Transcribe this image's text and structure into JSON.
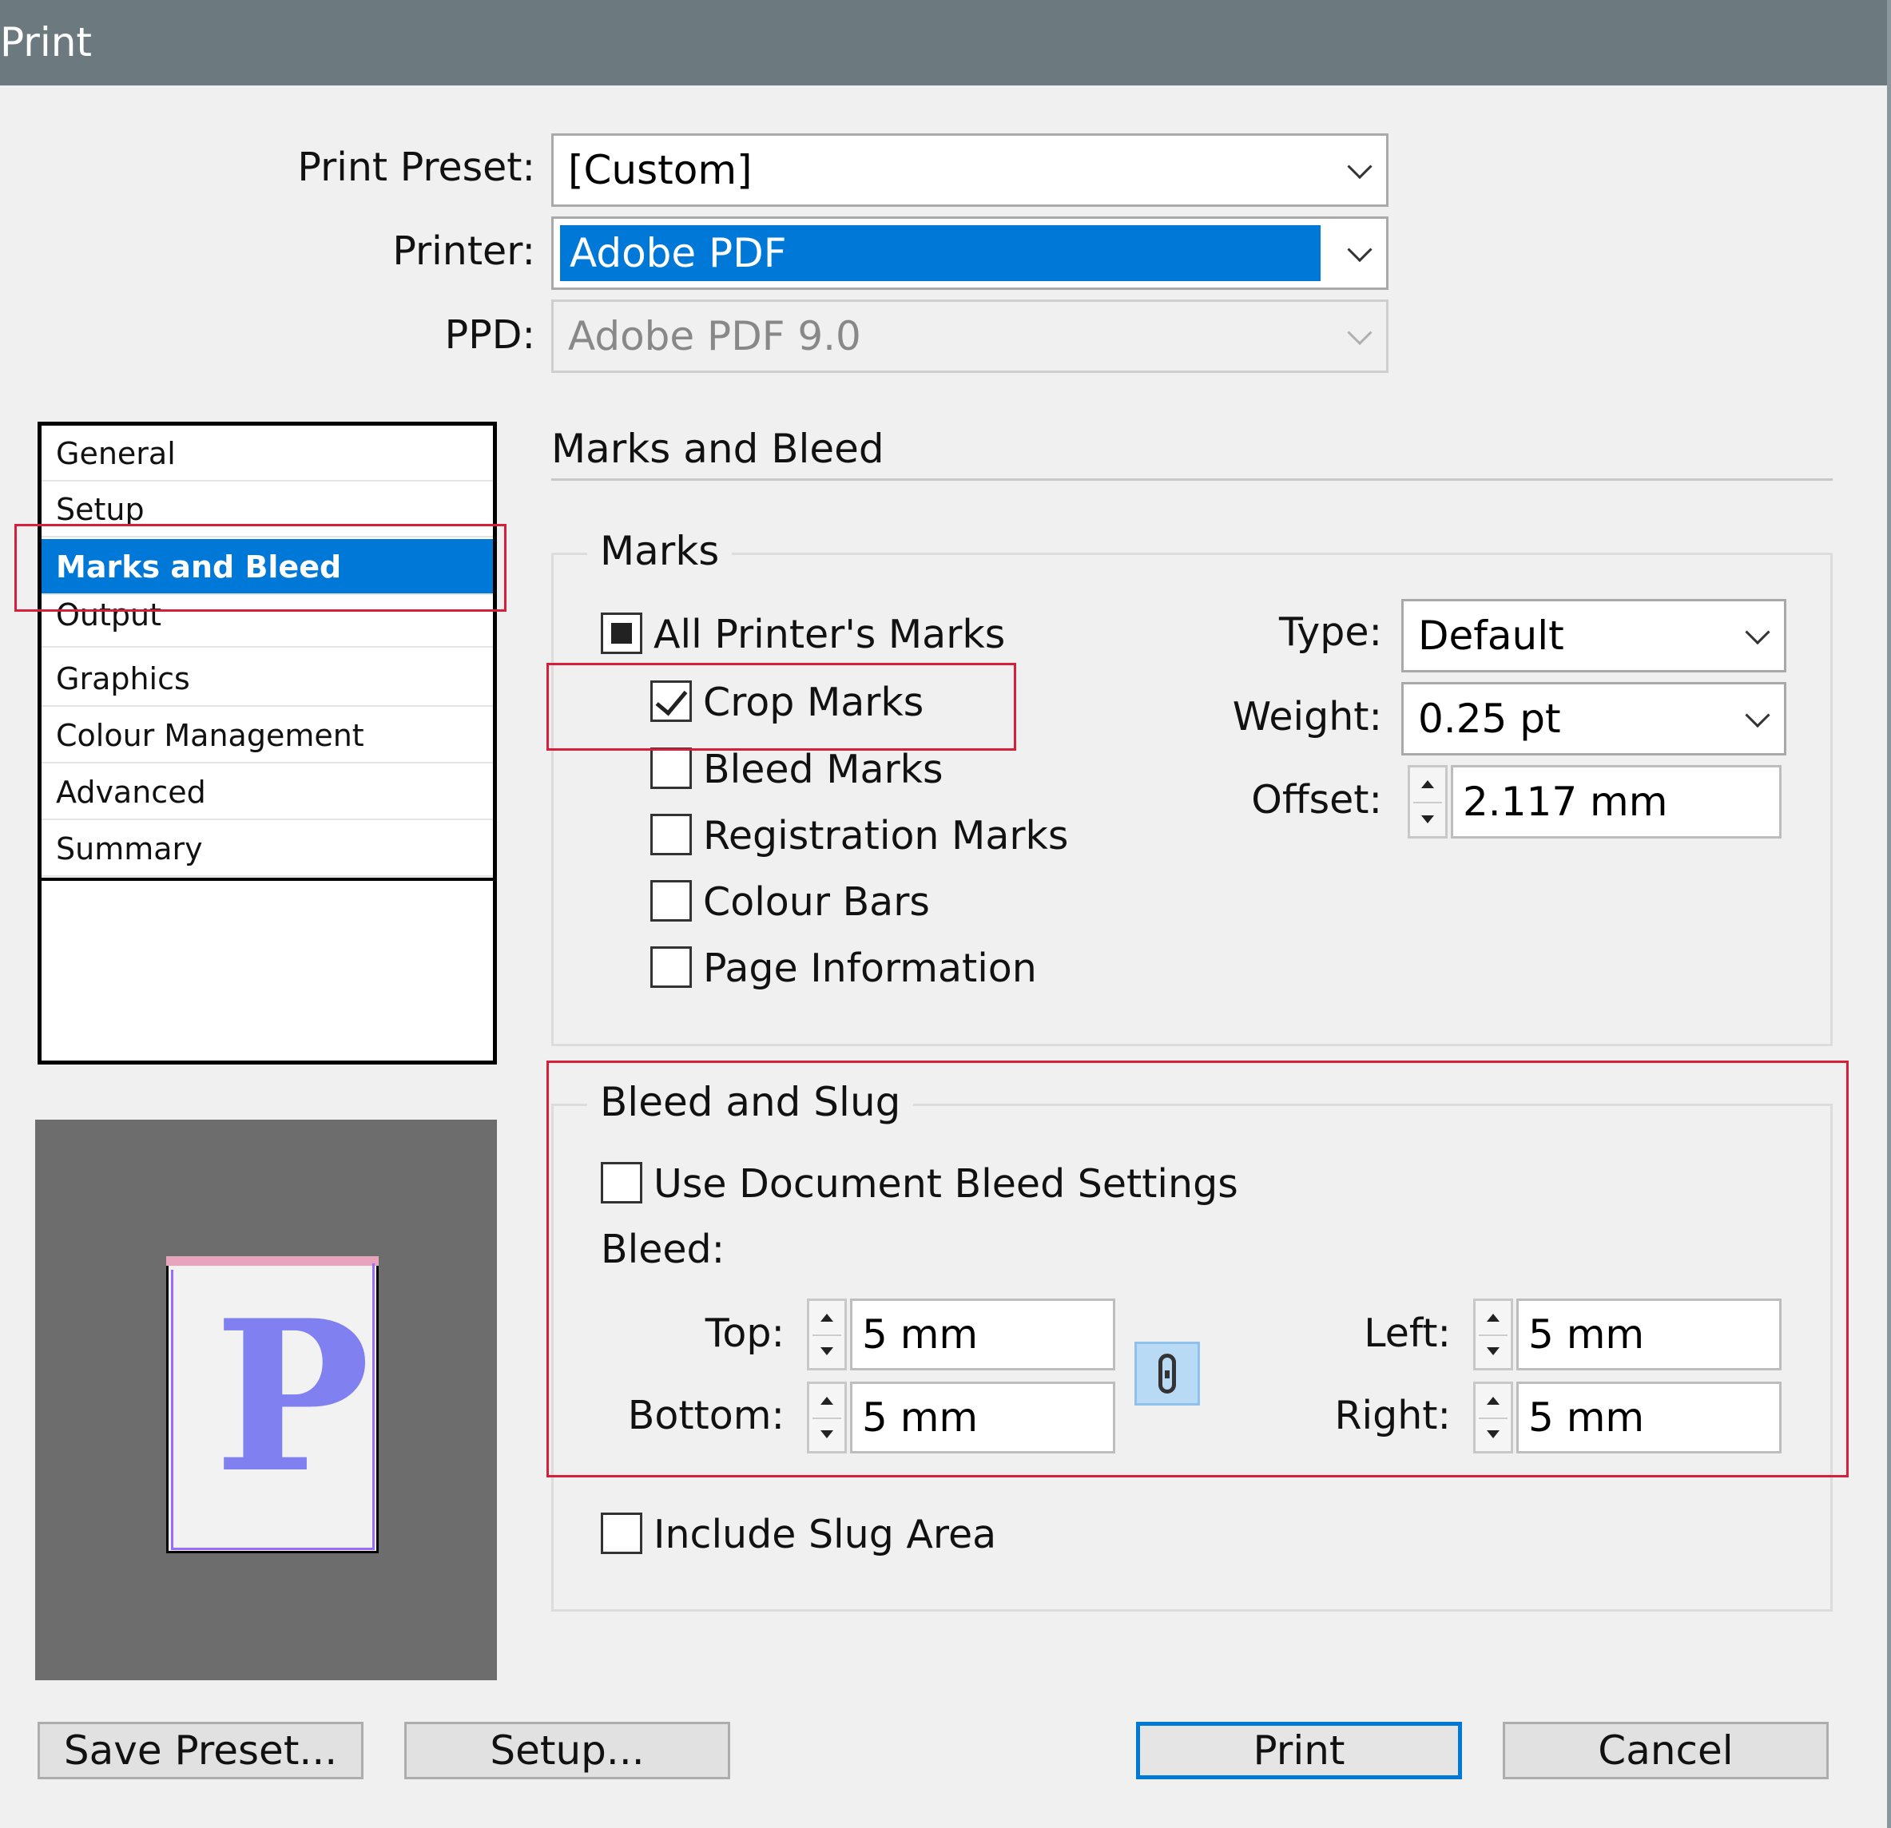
{
  "window": {
    "title": "Print"
  },
  "top": {
    "print_preset_label": "Print Preset:",
    "print_preset_value": "[Custom]",
    "printer_label": "Printer:",
    "printer_value": "Adobe PDF",
    "ppd_label": "PPD:",
    "ppd_value": "Adobe PDF 9.0"
  },
  "categories": [
    {
      "label": "General"
    },
    {
      "label": "Setup"
    },
    {
      "label": "Marks and Bleed",
      "selected": true
    },
    {
      "label": "Output"
    },
    {
      "label": "Graphics"
    },
    {
      "label": "Colour Management"
    },
    {
      "label": "Advanced"
    },
    {
      "label": "Summary"
    }
  ],
  "preview": {
    "glyph": "P"
  },
  "section": {
    "title": "Marks and Bleed"
  },
  "marks": {
    "legend": "Marks",
    "all_printers_marks": {
      "label": "All Printer's Marks",
      "state": "mixed"
    },
    "crop_marks": {
      "label": "Crop Marks",
      "checked": true
    },
    "bleed_marks": {
      "label": "Bleed Marks",
      "checked": false
    },
    "registration_marks": {
      "label": "Registration Marks",
      "checked": false
    },
    "colour_bars": {
      "label": "Colour Bars",
      "checked": false
    },
    "page_information": {
      "label": "Page Information",
      "checked": false
    },
    "type_label": "Type:",
    "type_value": "Default",
    "weight_label": "Weight:",
    "weight_value": "0.25 pt",
    "offset_label": "Offset:",
    "offset_value": "2.117 mm"
  },
  "bleed_slug": {
    "legend": "Bleed and Slug",
    "use_document_bleed": {
      "label": "Use Document Bleed Settings",
      "checked": false
    },
    "bleed_label": "Bleed:",
    "top_label": "Top:",
    "top_value": "5 mm",
    "bottom_label": "Bottom:",
    "bottom_value": "5 mm",
    "left_label": "Left:",
    "left_value": "5 mm",
    "right_label": "Right:",
    "right_value": "5 mm",
    "include_slug": {
      "label": "Include Slug Area",
      "checked": false
    }
  },
  "buttons": {
    "save_preset": "Save Preset...",
    "setup": "Setup...",
    "print": "Print",
    "cancel": "Cancel"
  },
  "colors": {
    "titlebar": "#6c7a80",
    "selection": "#0078d7",
    "highlight_box": "#d6203a"
  }
}
